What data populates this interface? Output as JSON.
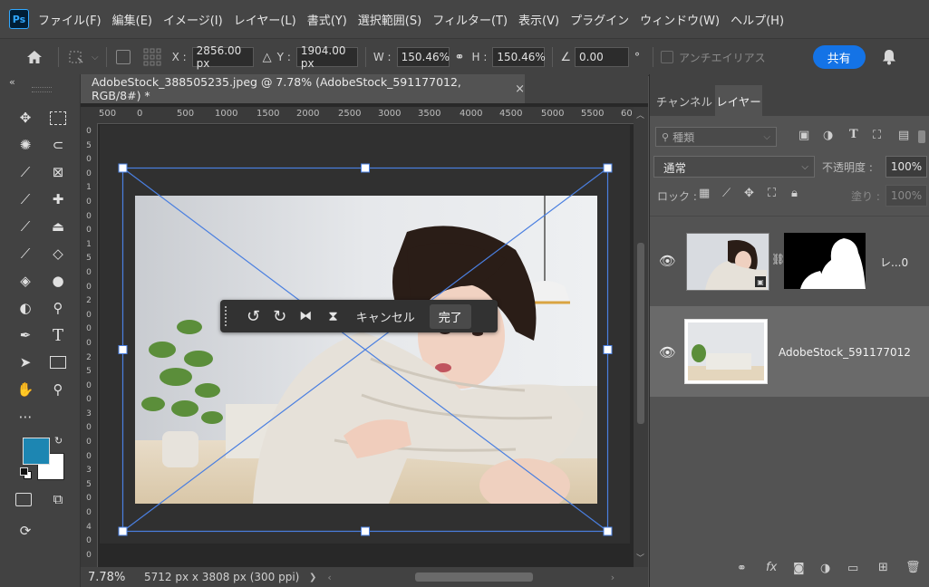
{
  "menu": {
    "logo": "Ps",
    "items": [
      "ファイル(F)",
      "編集(E)",
      "イメージ(I)",
      "レイヤー(L)",
      "書式(Y)",
      "選択範囲(S)",
      "フィルター(T)",
      "表示(V)",
      "プラグイン",
      "ウィンドウ(W)",
      "ヘルプ(H)"
    ]
  },
  "options": {
    "x_label": "X :",
    "x_value": "2856.00 px",
    "y_label": "Y :",
    "y_value": "1904.00 px",
    "w_label": "W :",
    "w_value": "150.46%",
    "h_label": "H :",
    "h_value": "150.46%",
    "angle_value": "0.00",
    "angle_unit": "°",
    "antialias": "アンチエイリアス",
    "share": "共有"
  },
  "document": {
    "tab_title": "AdobeStock_388505235.jpeg @ 7.78% (AdobeStock_591177012, RGB/8#) *",
    "tab_close": "×",
    "ruler_labels": [
      "500",
      "0",
      "500",
      "1000",
      "1500",
      "2000",
      "2500",
      "3000",
      "3500",
      "4000",
      "4500",
      "5000",
      "5500",
      "60"
    ],
    "vruler_labels": [
      "0",
      "5",
      "0",
      "0",
      "1",
      "0",
      "0",
      "0",
      "1",
      "5",
      "0",
      "0",
      "2",
      "0",
      "0",
      "0",
      "2",
      "5",
      "0",
      "0",
      "3",
      "0",
      "0",
      "0",
      "3",
      "5",
      "0",
      "0",
      "4",
      "0",
      "0"
    ]
  },
  "transform_bar": {
    "cancel": "キャンセル",
    "done": "完了"
  },
  "status": {
    "zoom": "7.78%",
    "info": "5712 px x 3808 px (300 ppi)",
    "arrow": "❯"
  },
  "panel": {
    "tab_channels": "チャンネル",
    "tab_layers": "レイヤー",
    "filter_placeholder": "種類",
    "blend_mode": "通常",
    "opacity_label": "不透明度 :",
    "opacity_value": "100%",
    "lock_label": "ロック :",
    "fill_label": "塗り :",
    "fill_value": "100%",
    "layers": [
      {
        "name": "レ...0"
      },
      {
        "name": "AdobeStock_591177012"
      }
    ]
  },
  "colors": {
    "foreground": "#1d86b2",
    "background": "#ffffff",
    "accent": "#1473e6",
    "transform_line": "#4a7fe0"
  }
}
